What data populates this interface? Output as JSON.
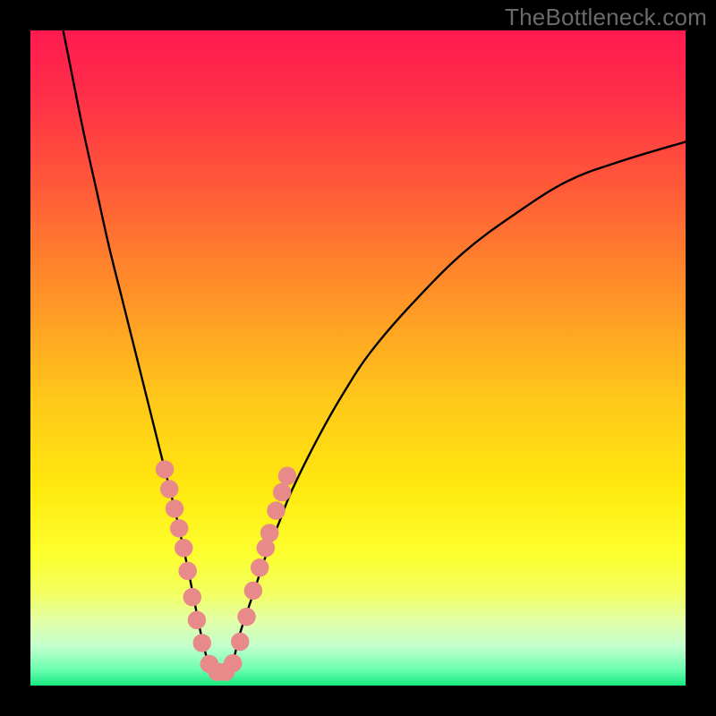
{
  "watermark": "TheBottleneck.com",
  "chart_data": {
    "type": "line",
    "title": "",
    "xlabel": "",
    "ylabel": "",
    "xlim": [
      0,
      100
    ],
    "ylim": [
      0,
      100
    ],
    "gradient_stops": [
      {
        "offset": 0,
        "color": "#ff1a4f"
      },
      {
        "offset": 0.1,
        "color": "#ff2f48"
      },
      {
        "offset": 0.24,
        "color": "#ff5a38"
      },
      {
        "offset": 0.38,
        "color": "#ff8a2a"
      },
      {
        "offset": 0.55,
        "color": "#ffc41b"
      },
      {
        "offset": 0.7,
        "color": "#ffe90f"
      },
      {
        "offset": 0.8,
        "color": "#fcff2e"
      },
      {
        "offset": 0.86,
        "color": "#f3ff62"
      },
      {
        "offset": 0.9,
        "color": "#e2ffa6"
      },
      {
        "offset": 0.94,
        "color": "#c3ffce"
      },
      {
        "offset": 0.975,
        "color": "#6dffb0"
      },
      {
        "offset": 1.0,
        "color": "#18e980"
      }
    ],
    "series": [
      {
        "name": "bottleneck-curve",
        "x": [
          5,
          6,
          8,
          10,
          12,
          14,
          16,
          18,
          20,
          22,
          24,
          25,
          26,
          27,
          28,
          29,
          30,
          31,
          32,
          34,
          36,
          38,
          40,
          44,
          48,
          52,
          58,
          66,
          74,
          82,
          90,
          100
        ],
        "values": [
          100,
          95,
          85,
          76,
          67,
          59,
          51,
          43,
          35,
          27,
          18,
          13,
          8,
          4,
          2,
          1.5,
          2,
          4,
          8,
          14,
          20,
          25,
          30,
          38,
          45,
          51,
          58,
          66,
          72,
          77,
          80,
          83
        ]
      }
    ],
    "markers": {
      "name": "highlight-dots",
      "color": "#e98a8a",
      "radius_pct": 1.4,
      "points": [
        {
          "x": 20.5,
          "y": 33
        },
        {
          "x": 21.2,
          "y": 30
        },
        {
          "x": 22.0,
          "y": 27
        },
        {
          "x": 22.7,
          "y": 24
        },
        {
          "x": 23.4,
          "y": 21
        },
        {
          "x": 24.0,
          "y": 17.5
        },
        {
          "x": 24.7,
          "y": 13.5
        },
        {
          "x": 25.4,
          "y": 10
        },
        {
          "x": 26.2,
          "y": 6.5
        },
        {
          "x": 27.3,
          "y": 3.3
        },
        {
          "x": 28.5,
          "y": 2.1
        },
        {
          "x": 29.8,
          "y": 2.1
        },
        {
          "x": 30.9,
          "y": 3.4
        },
        {
          "x": 32.0,
          "y": 6.7
        },
        {
          "x": 33.0,
          "y": 10.5
        },
        {
          "x": 34.0,
          "y": 14.5
        },
        {
          "x": 35.0,
          "y": 18
        },
        {
          "x": 35.9,
          "y": 21
        },
        {
          "x": 36.5,
          "y": 23.3
        },
        {
          "x": 37.5,
          "y": 26.7
        },
        {
          "x": 38.4,
          "y": 29.5
        },
        {
          "x": 39.2,
          "y": 32
        }
      ]
    }
  }
}
